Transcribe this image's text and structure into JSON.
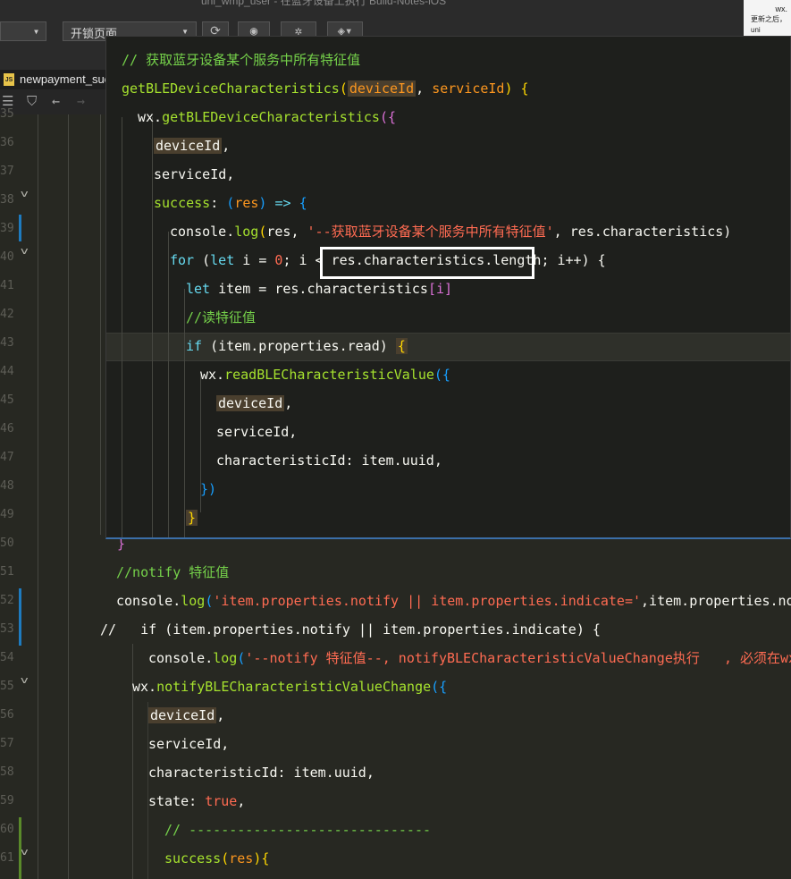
{
  "window": {
    "title": "uni_wmp_user - 在蓝牙设备上执行 Build-Notes-iOS"
  },
  "toolbar": {
    "page_select": "开锁页面",
    "refresh_icon": "refresh-icon",
    "eye_icon": "eye-icon",
    "bug_icon": "bug-icon",
    "layers_icon": "layers-icon"
  },
  "preview": {
    "title": "wx.",
    "text": "更新之后，uni"
  },
  "tab": {
    "label": "newpayment_suc",
    "badge": "JS"
  },
  "gutter": {
    "line_numbers": [
      "35",
      "36",
      "37",
      "38",
      "39",
      "40",
      "41",
      "42",
      "43",
      "44",
      "45",
      "46",
      "47",
      "48",
      "49",
      "50",
      "51",
      "52",
      "53",
      "54",
      "55",
      "56",
      "57",
      "58",
      "59",
      "60",
      "61"
    ]
  },
  "popup": {
    "comment": "// 获取蓝牙设备某个服务中所有特征值",
    "func_name": "getBLEDeviceCharacteristics",
    "param1": "deviceId",
    "param2": "serviceId",
    "call_obj": "wx.",
    "call_fn": "getBLEDeviceCharacteristics",
    "prop_deviceId": "deviceId",
    "prop_serviceId": "serviceId",
    "success_key": "success",
    "success_param": "res",
    "log_prefix": "console.",
    "log_fn": "log",
    "log_arg1": "res, ",
    "log_str": "'--获取蓝牙设备某个服务中所有特征值'",
    "log_arg2": ", res.characteristics)",
    "for_kw": "for",
    "let_kw": "let",
    "for_part1": " i = ",
    "for_zero": "0",
    "for_part2": "; i < ",
    "for_len": "res.characteristics.length",
    "for_part3": "; i++) {",
    "item_decl": " item = res.characteristics",
    "item_idx": "[i]",
    "read_comment": "//读特征值",
    "if_kw": "if",
    "if_cond": " (item.properties.read) ",
    "read_obj": "wx.",
    "read_fn": "readBLECharacteristicValue",
    "prop_characteristicId": "characteristicId: item.uuid,"
  },
  "editor": {
    "notify_comment": "//notify 特征值",
    "log_notify_prefix": "console.",
    "log_notify_fn": "log",
    "log_notify_str": "'item.properties.notify || item.properties.indicate='",
    "log_notify_rest": ",item.properties.notify",
    "commented_if": "//   if (item.properties.notify || item.properties.indicate) {",
    "log2_str": "'--notify 特征值--, notifyBLECharacteristicValueChange执行   , 必须在wx.",
    "notify_obj": "wx.",
    "notify_fn": "notifyBLECharacteristicValueChange",
    "prop_deviceId": "deviceId",
    "prop_serviceId": "serviceId,",
    "prop_characteristicId": "characteristicId: item.uuid,",
    "state_key": "state: ",
    "state_val": "true",
    "dash_comment": "// ------------------------------",
    "success_key": "success",
    "success_param": "res"
  }
}
